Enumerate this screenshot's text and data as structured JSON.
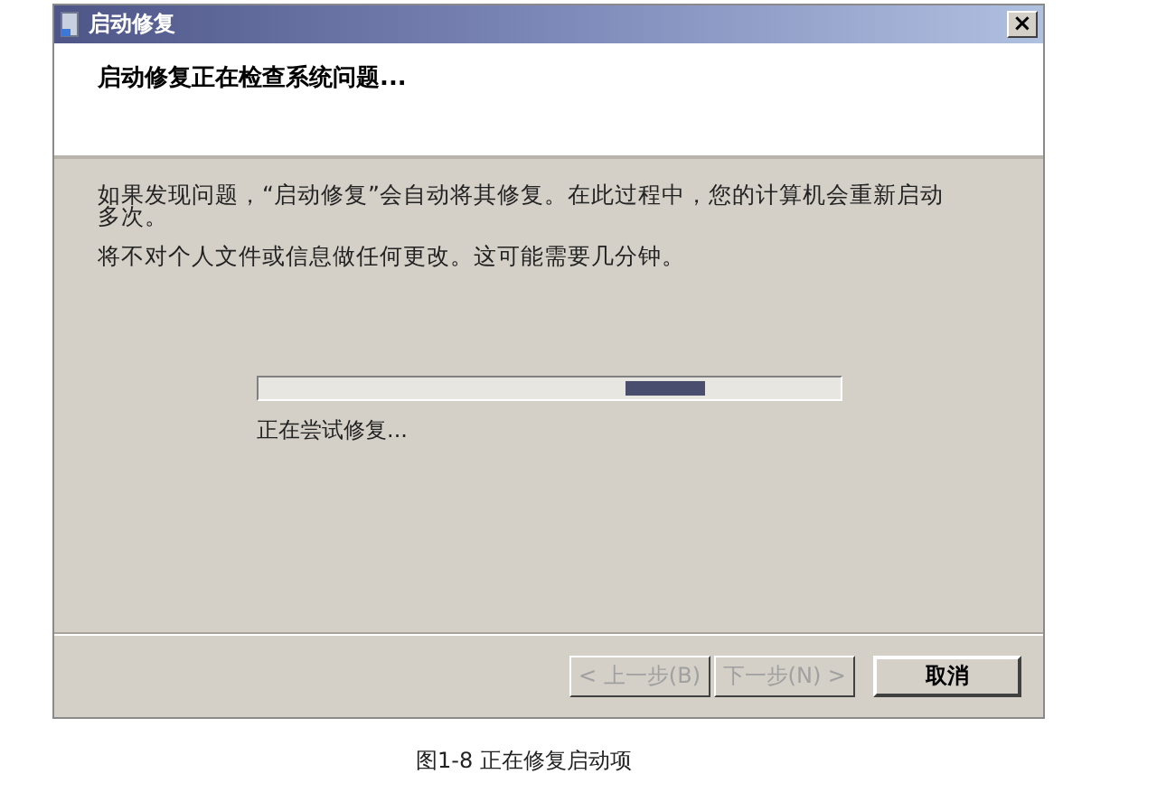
{
  "window": {
    "title": "启动修复",
    "close": "×"
  },
  "header": {
    "heading": "启动修复正在检查系统问题..."
  },
  "body": {
    "paragraphs": [
      "如果发现问题，“启动修复”会自动将其修复。在此过程中，您的计算机会重新启动多次。",
      "将不对个人文件或信息做任何更改。这可能需要几分钟。"
    ],
    "progress": {
      "kind": "marquee",
      "status": "正在尝试修复..."
    }
  },
  "buttons": [
    {
      "label": "< 上一步(B)",
      "disabled": true
    },
    {
      "label": "下一步(N) >",
      "disabled": true
    },
    {
      "label": "取消",
      "disabled": false
    }
  ],
  "caption": "图1-8 正在修复启动项"
}
